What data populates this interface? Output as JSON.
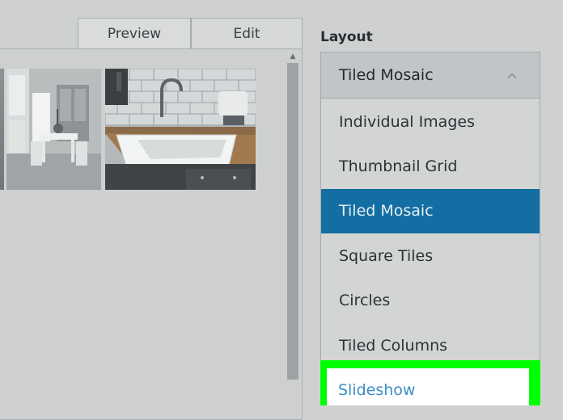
{
  "tabs": {
    "preview": "Preview",
    "edit": "Edit"
  },
  "layout": {
    "heading": "Layout",
    "selected_value": "Tiled Mosaic",
    "options": [
      "Individual Images",
      "Thumbnail Grid",
      "Tiled Mosaic",
      "Square Tiles",
      "Circles",
      "Tiled Columns",
      "Slideshow"
    ],
    "selected_index": 2,
    "highlighted_option": "Slideshow"
  },
  "colors": {
    "selected_bg": "#146ea3",
    "highlight_outline": "#00ff00",
    "link_text": "#3d8ec6"
  },
  "icons": {
    "dropdown_toggle": "chevron-up-icon",
    "scroll_up": "scroll-up-arrow-icon"
  }
}
